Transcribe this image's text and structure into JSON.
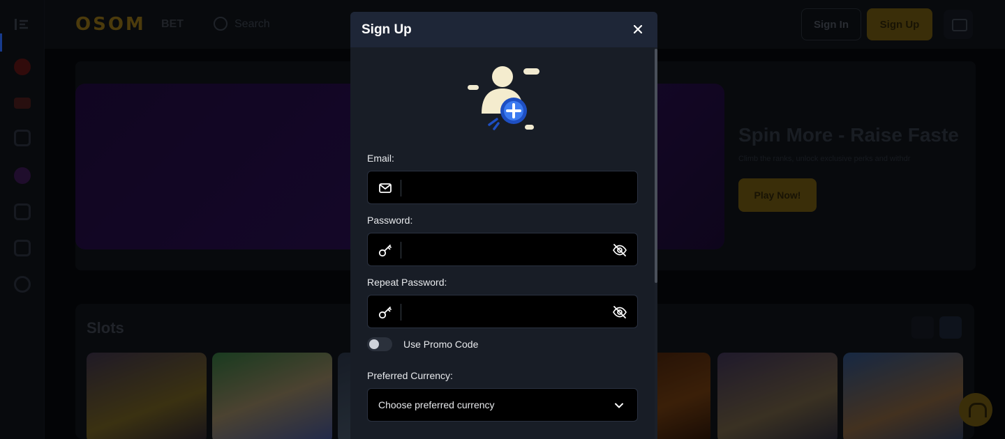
{
  "brand": {
    "logo_text": "OSOM",
    "logo_suffix": "BET"
  },
  "topbar": {
    "search_placeholder": "Search",
    "signin_label": "Sign In",
    "signup_label": "Sign Up"
  },
  "hero": {
    "title": "Spin More - Raise Faste",
    "subtitle": "Climb the ranks, unlock exclusive perks and withdr",
    "cta_label": "Play Now!"
  },
  "slots": {
    "title": "Slots"
  },
  "modal": {
    "title": "Sign Up",
    "email_label": "Email:",
    "password_label": "Password:",
    "repeat_password_label": "Repeat Password:",
    "promo_toggle_label": "Use Promo Code",
    "currency_label": "Preferred Currency:",
    "currency_value": "Choose preferred currency"
  },
  "colors": {
    "accent": "#2b6cff",
    "brand_gold": "#e6b422",
    "modal_bg": "#181d26",
    "modal_header": "#1e2637"
  }
}
